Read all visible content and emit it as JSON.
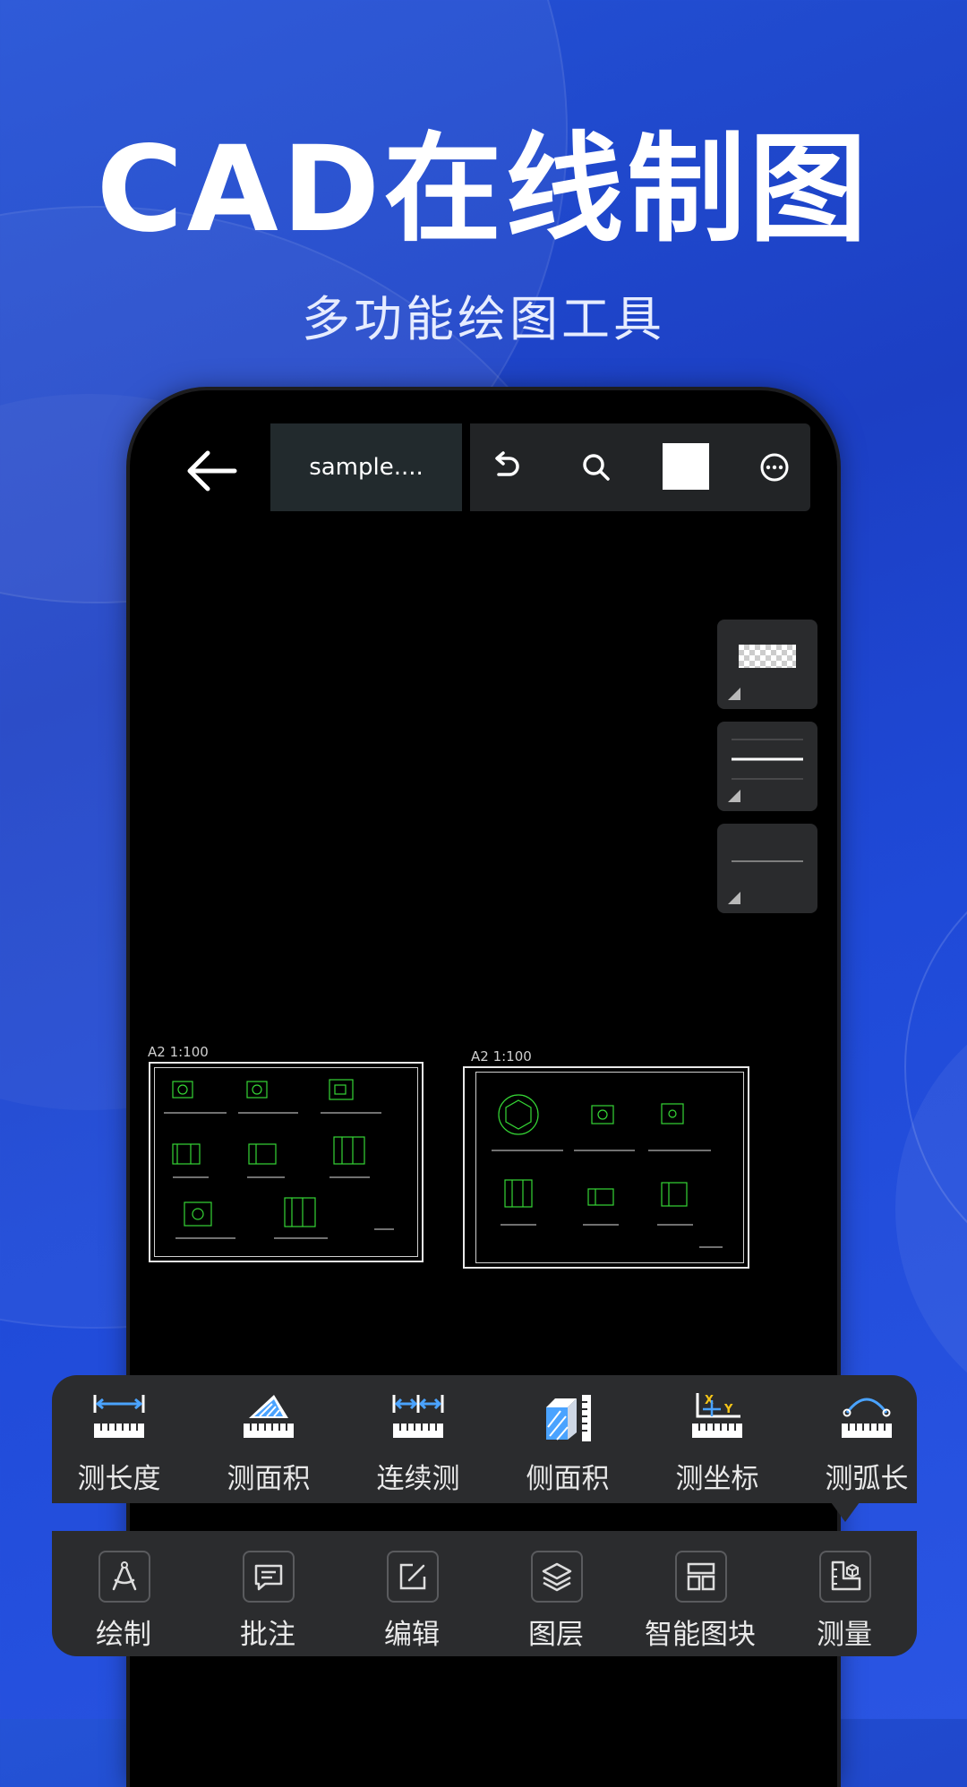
{
  "promo": {
    "headline": "CAD在线制图",
    "subheadline": "多功能绘图工具"
  },
  "toolbar": {
    "file_tab_label": "sample....",
    "back_icon": "arrow-left-icon",
    "undo_icon": "undo-icon",
    "search_icon": "search-icon",
    "color_swatch": "#ffffff",
    "more_icon": "more-horizontal-icon"
  },
  "side_panel": {
    "items": [
      {
        "name": "fill-pattern",
        "icon": "checker-pattern-icon"
      },
      {
        "name": "line-weight",
        "icon": "line-weight-icon"
      },
      {
        "name": "line-type",
        "icon": "line-type-icon"
      }
    ]
  },
  "drawings": [
    {
      "label": "A2 1:100"
    },
    {
      "label": "A2 1:100"
    }
  ],
  "measure_tools": [
    {
      "label": "测长度",
      "icon": "measure-length-icon"
    },
    {
      "label": "测面积",
      "icon": "measure-area-icon"
    },
    {
      "label": "连续测",
      "icon": "continuous-measure-icon"
    },
    {
      "label": "侧面积",
      "icon": "side-area-icon"
    },
    {
      "label": "测坐标",
      "icon": "measure-coordinate-icon"
    },
    {
      "label": "测弧长",
      "icon": "measure-arc-icon"
    }
  ],
  "bottom_tabs": [
    {
      "label": "绘制",
      "icon": "compass-draw-icon"
    },
    {
      "label": "批注",
      "icon": "annotation-icon"
    },
    {
      "label": "编辑",
      "icon": "edit-icon"
    },
    {
      "label": "图层",
      "icon": "layers-icon"
    },
    {
      "label": "智能图块",
      "icon": "smart-block-icon"
    },
    {
      "label": "测量",
      "icon": "measure-icon"
    }
  ],
  "colors": {
    "background": "#1f48d4",
    "canvas": "#000000",
    "panel": "#2b2c2e",
    "accent_blue": "#4aa3ff",
    "accent_yellow": "#f5c518"
  }
}
